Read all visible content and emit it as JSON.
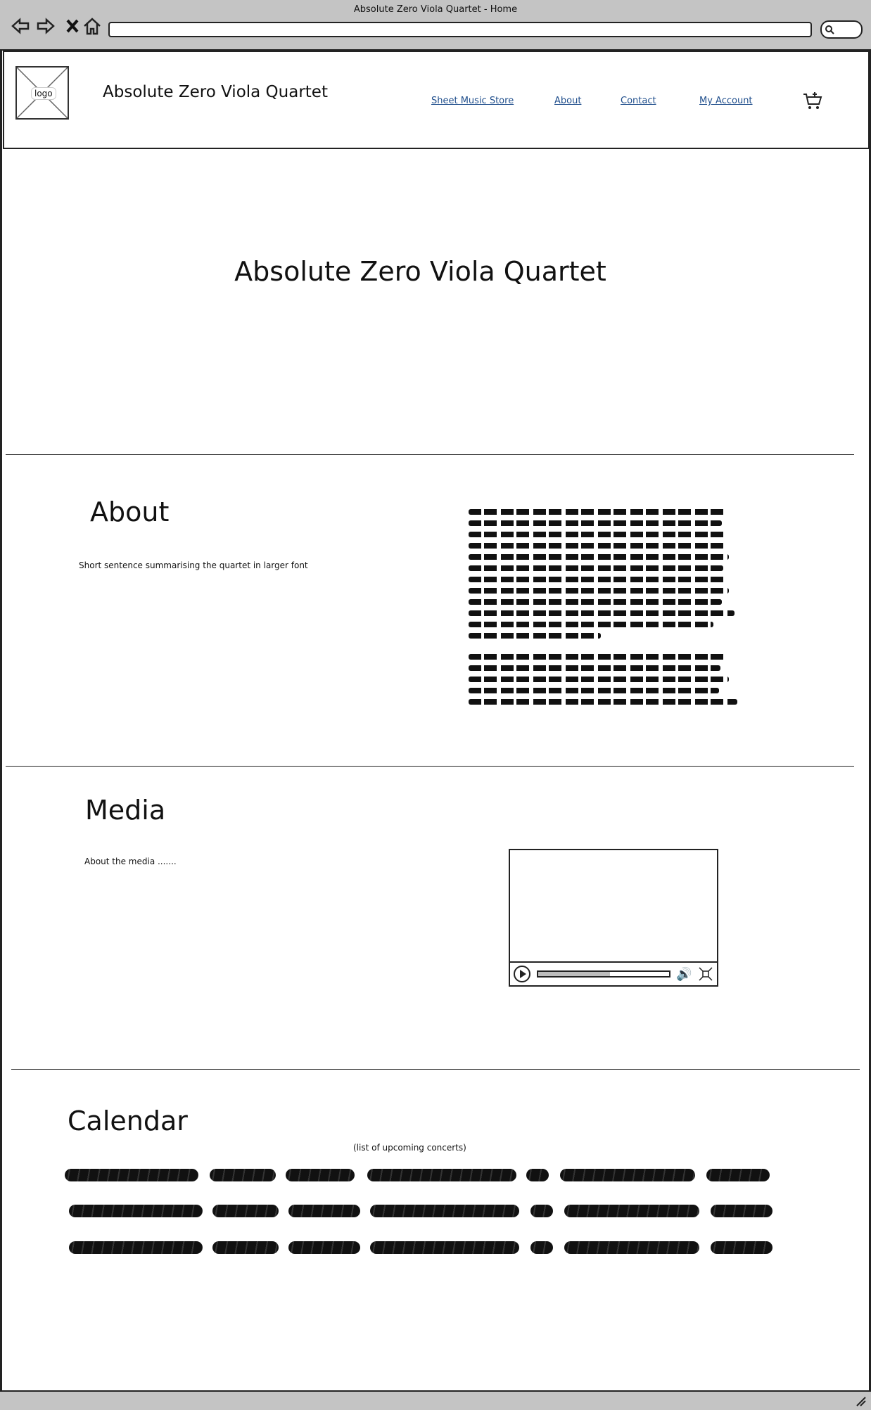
{
  "browser": {
    "window_title": "Absolute Zero Viola Quartet - Home"
  },
  "header": {
    "logo_label": "logo",
    "brand": "Absolute Zero Viola Quartet",
    "nav": [
      "Sheet Music Store",
      "About",
      "Contact",
      "My Account"
    ],
    "cart_icon": "cart-add-icon"
  },
  "hero": {
    "title": "Absolute Zero Viola Quartet"
  },
  "about": {
    "title": "About",
    "summary": "Short sentence summarising the quartet in larger font"
  },
  "media": {
    "title": "Media",
    "description": "About the media .......",
    "video": {
      "progress": 0.55
    }
  },
  "calendar": {
    "title": "Calendar",
    "subtitle": "(list of upcoming concerts)"
  }
}
